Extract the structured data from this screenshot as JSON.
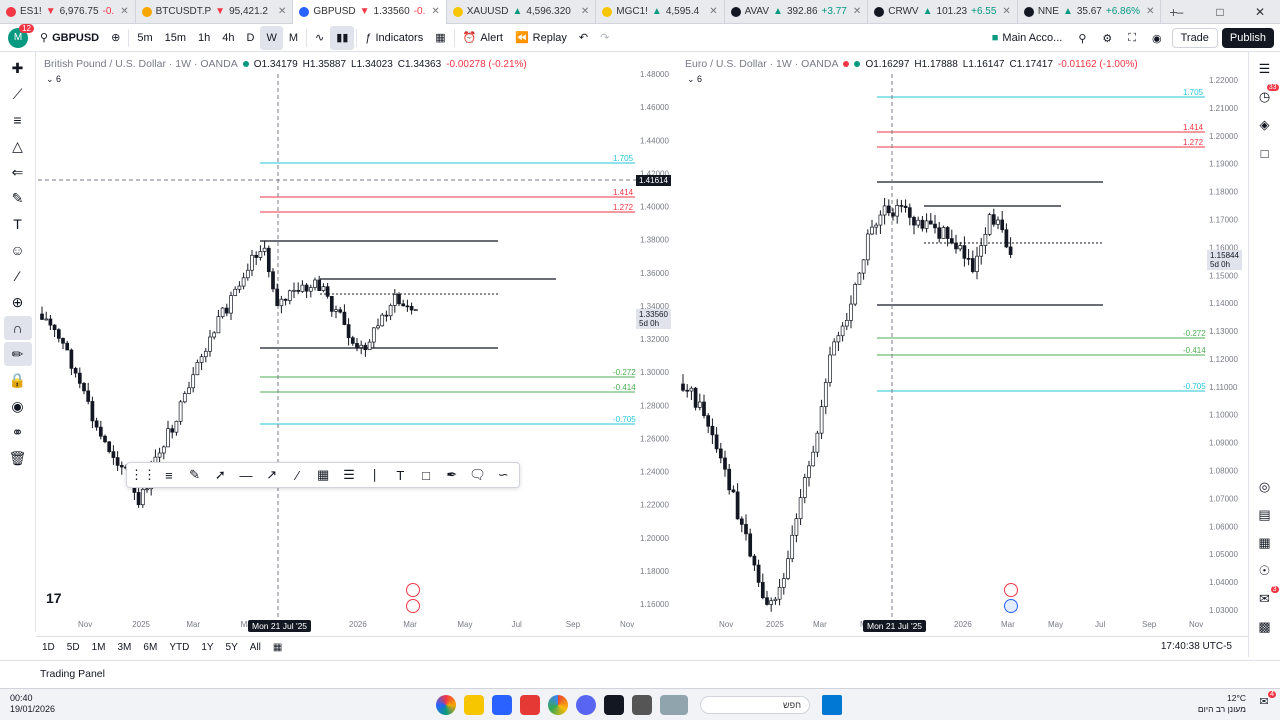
{
  "tabs": [
    {
      "symbol": "ES1!",
      "price": "6,976.75",
      "change": "-0.",
      "dir": "down",
      "color": "#f23645",
      "active": false
    },
    {
      "symbol": "BTCUSDT.P",
      "price": "95,421.2",
      "change": "",
      "dir": "down",
      "color": "#f7a600",
      "active": false
    },
    {
      "symbol": "GBPUSD",
      "price": "1.33560",
      "change": "-0.",
      "dir": "down",
      "color": "#2962ff",
      "active": true
    },
    {
      "symbol": "XAUUSD",
      "price": "4,596.320",
      "change": "",
      "dir": "up",
      "color": "#f7c600",
      "active": false
    },
    {
      "symbol": "MGC1!",
      "price": "4,595.4",
      "change": "",
      "dir": "up",
      "color": "#f7c600",
      "active": false
    },
    {
      "symbol": "AVAV",
      "price": "392.86",
      "change": "+3.77",
      "dir": "up",
      "color": "#131722",
      "active": false
    },
    {
      "symbol": "CRWV",
      "price": "101.23",
      "change": "+6.55",
      "dir": "up",
      "color": "#131722",
      "active": false
    },
    {
      "symbol": "NNE",
      "price": "35.67",
      "change": "+6.86%",
      "dir": "up",
      "color": "#131722",
      "active": false
    }
  ],
  "toolbar": {
    "avatar": "M",
    "avatar_badge": "12",
    "symbol": "GBPUSD",
    "intervals": [
      "5m",
      "15m",
      "1h",
      "4h",
      "D",
      "W",
      "M"
    ],
    "active_interval": "W",
    "indicators": "Indicators",
    "alert": "Alert",
    "replay": "Replay",
    "layout": "Main Acco...",
    "trade": "Trade",
    "publish": "Publish"
  },
  "panes": [
    {
      "name": "British Pound / U.S. Dollar · 1W · OANDA",
      "ohlc": {
        "o": "1.34179",
        "h": "1.35887",
        "l": "1.34023",
        "c": "1.34363",
        "chg": "-0.00278 (-0.21%)"
      },
      "studies": "6",
      "price_axis": [
        "1.48000",
        "1.46000",
        "1.44000",
        "1.42000",
        "1.40000",
        "1.38000",
        "1.36000",
        "1.34000",
        "1.32000",
        "1.30000",
        "1.28000",
        "1.26000",
        "1.24000",
        "1.22000",
        "1.20000",
        "1.18000",
        "1.16000"
      ],
      "time_axis": [
        "Nov",
        "2025",
        "Mar",
        "May",
        "Nov",
        "2026",
        "Mar",
        "May",
        "Jul",
        "Sep",
        "Nov"
      ],
      "date_tag": "Mon 21 Jul '25",
      "crosshair_price": "1.41614",
      "last_price": "1.33560",
      "last_countdown": "5d 0h",
      "fib_levels": [
        {
          "label": "1.705",
          "color": "#26c6da"
        },
        {
          "label": "1.414",
          "color": "#f23645"
        },
        {
          "label": "1.272",
          "color": "#f23645"
        },
        {
          "label": "-0.272",
          "color": "#4caf50"
        },
        {
          "label": "-0.414",
          "color": "#4caf50"
        },
        {
          "label": "-0.705",
          "color": "#26c6da"
        }
      ]
    },
    {
      "name": "Euro / U.S. Dollar · 1W · OANDA",
      "ohlc": {
        "o": "1.16297",
        "h": "1.17888",
        "l": "1.16147",
        "c": "1.17417",
        "chg": "-0.01162 (-1.00%)"
      },
      "studies": "6",
      "price_axis": [
        "1.22000",
        "1.21000",
        "1.20000",
        "1.19000",
        "1.18000",
        "1.17000",
        "1.16000",
        "1.15000",
        "1.14000",
        "1.13000",
        "1.12000",
        "1.11000",
        "1.10000",
        "1.09000",
        "1.08000",
        "1.07000",
        "1.06000",
        "1.05000",
        "1.04000",
        "1.03000"
      ],
      "time_axis": [
        "Nov",
        "2025",
        "Mar",
        "May",
        "Nov",
        "2026",
        "Mar",
        "May",
        "Jul",
        "Sep",
        "Nov"
      ],
      "date_tag": "Mon 21 Jul '25",
      "last_price": "1.15844",
      "last_countdown": "5d 0h",
      "fib_levels": [
        {
          "label": "1.705",
          "color": "#26c6da"
        },
        {
          "label": "1.414",
          "color": "#f23645"
        },
        {
          "label": "1.272",
          "color": "#f23645"
        },
        {
          "label": "-0.272",
          "color": "#4caf50"
        },
        {
          "label": "-0.414",
          "color": "#4caf50"
        },
        {
          "label": "-0.705",
          "color": "#26c6da"
        }
      ]
    }
  ],
  "bottombar": {
    "ranges": [
      "1D",
      "5D",
      "1M",
      "3M",
      "6M",
      "YTD",
      "1Y",
      "5Y",
      "All"
    ],
    "clock": "17:40:38 UTC-5"
  },
  "trading_panel": "Trading Panel",
  "taskbar": {
    "time": "00:40",
    "date": "19/01/2026",
    "search": "חפש",
    "temp": "12°C",
    "weather": "מעונן רב היום",
    "notif_count": "4"
  },
  "right_badges": {
    "alerts": "33",
    "notifications": "3"
  },
  "tv_logo": "17"
}
